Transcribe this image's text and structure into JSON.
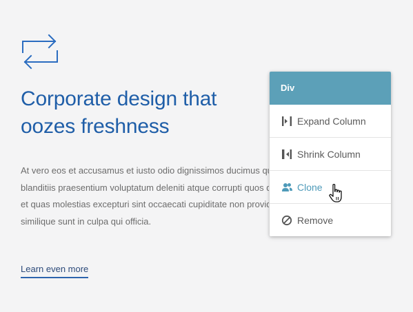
{
  "hero": {
    "icon": "repeat-arrows-icon",
    "headline_line1": "Corporate design that",
    "headline_line2": "oozes freshness",
    "body_lines": [
      "At vero eos et accusamus et iusto odio dignissimos ducimus qui",
      "blanditiis praesentium voluptatum deleniti atque corrupti quos dolores",
      "et quas molestias excepturi sint occaecati cupiditate non provident,",
      "similique sunt in culpa qui officia."
    ],
    "link_label": "Learn even more"
  },
  "context_menu": {
    "header": "Div",
    "items": [
      {
        "label": "Expand Column",
        "icon": "expand-column-icon"
      },
      {
        "label": "Shrink Column",
        "icon": "shrink-column-icon"
      },
      {
        "label": "Clone",
        "icon": "clone-users-icon",
        "state": "hover"
      },
      {
        "label": "Remove",
        "icon": "remove-circle-icon"
      }
    ]
  },
  "colors": {
    "accent_blue": "#1f5ea8",
    "menu_header": "#5ca0b8",
    "menu_hover": "#4e9ab9",
    "background": "#f4f4f5"
  },
  "cursor": "hand-pointer-icon"
}
